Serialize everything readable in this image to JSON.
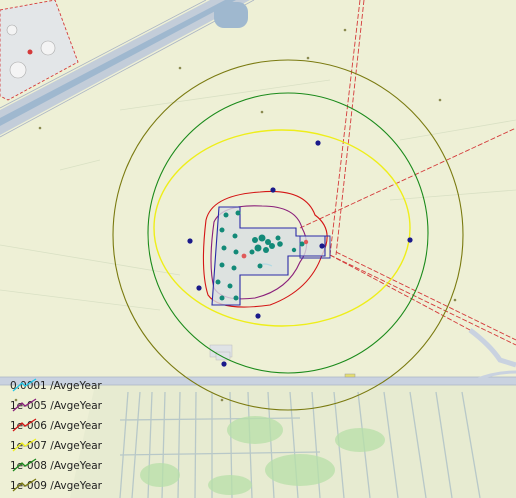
{
  "legend": {
    "items": [
      {
        "label": "0.0001 /AvgeYear",
        "color": "#21c7e6",
        "icon": "contour-line-icon"
      },
      {
        "label": "1e-005 /AvgeYear",
        "color": "#8a1f7a",
        "icon": "contour-line-icon"
      },
      {
        "label": "1e-006 /AvgeYear",
        "color": "#d41515",
        "icon": "contour-line-icon"
      },
      {
        "label": "1e-007 /AvgeYear",
        "color": "#eeee1a",
        "icon": "contour-line-icon"
      },
      {
        "label": "1e-008 /AvgeYear",
        "color": "#1a8a1a",
        "icon": "contour-line-icon"
      },
      {
        "label": "1e-009 /AvgeYear",
        "color": "#7a7a10",
        "icon": "contour-line-icon"
      }
    ]
  },
  "map": {
    "colors": {
      "background": "#eef0d6",
      "site_boundary": "#2a2aa8",
      "equipment": "#138a78",
      "pipeline": "#d43a3a",
      "road": "#c9d2e0",
      "water": "#9fb8cf",
      "field_lines": "#b8c8c8"
    }
  }
}
